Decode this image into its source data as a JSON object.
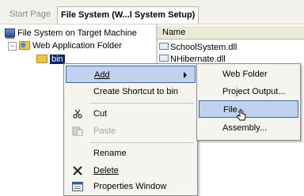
{
  "tabs": {
    "start_page": "Start Page",
    "file_system": "File System (W...l System Setup)"
  },
  "tree": {
    "root_label": "File System on Target Machine",
    "web_app_folder": "Web Application Folder",
    "expander_symbol": "−",
    "bin": "bin"
  },
  "right_pane": {
    "column_name": "Name",
    "files": [
      "SchoolSystem.dll",
      "NHibernate.dll"
    ]
  },
  "context_menu": {
    "add": "Add",
    "create_shortcut": "Create Shortcut to bin",
    "cut": "Cut",
    "paste": "Paste",
    "rename": "Rename",
    "delete": "Delete",
    "properties_window": "Properties Window"
  },
  "submenu": {
    "web_folder": "Web Folder",
    "project_output": "Project Output...",
    "file": "File...",
    "assembly": "Assembly..."
  },
  "colors": {
    "selection": "#0a246a",
    "menu_highlight": "#c1d2ee",
    "highlight_border": "#316ac5"
  }
}
